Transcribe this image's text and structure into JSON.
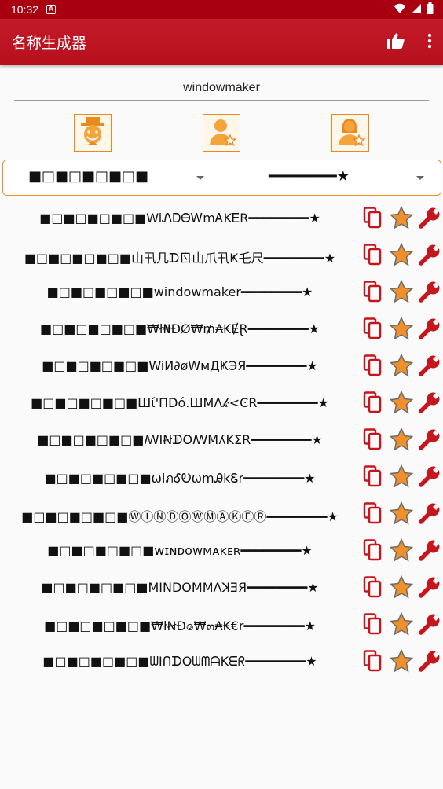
{
  "status_bar": {
    "time": "10:32",
    "notification_glyph": "A"
  },
  "app_bar": {
    "title": "名称生成器"
  },
  "input": {
    "value": "windowmaker"
  },
  "selectors": {
    "prefix": "■□■□■□■□■",
    "suffix": "━━━━━━━━★"
  },
  "names": [
    "■□■□■□■□■WiᏁᎠᎾᎳmᎪKᎬR━━━━━━━━★",
    "■□■□■□■□■山卂几ᗪㄖ山爪卂Ҝ乇尺━━━━━━━━★",
    "■□■□■□■□■windowmaker━━━━━━━━★",
    "■□■□■□■□■₩ł₦ĐØ₩₥₳₭ɆⱤ━━━━━━━━★",
    "■□■□■□■□■WiИ∂øWмДҜЭЯ━━━━━━━━★",
    "■□■□■□■□■Шί'ПDό.ШМΛ𝓀<ϾR━━━━━━━━★",
    "■□■□■□■□■ꟿIꞤᗫOꟿMʎKΣR━━━━━━━━★",
    "■□■□■□■□■ωiภᎴᎧωmᎯkᏋr━━━━━━━━★",
    "■□■□■□■□■ⓌⒾⓃⒹⓄⓌⓂⒶⓀⒺⓇ━━━━━━━━★",
    "■□■□■□■□■ᴡɪɴᴅᴏᴡᴍᴀᴋᴇʀ━━━━━━━━★",
    "■□■□■□■□■MINDOMMɅꓘƎЯ━━━━━━━━★",
    "■□■□■□■□■₩łꞤÐ๏₩๓₳₭€r━━━━━━━━★",
    "■□■□■□■□■ᗯIᑎᗪOᗯᗰᗩKᗴᖇ━━━━━━━━★"
  ],
  "colors": {
    "primary": "#b7101d",
    "accent": "#f0902a",
    "star": "#f0902a",
    "wrench": "#c4161c",
    "copy": "#c4161c"
  },
  "icons": [
    "thumb-up-icon",
    "more-vert-icon",
    "joker-avatar-icon",
    "male-star-avatar-icon",
    "female-star-avatar-icon",
    "copy-icon",
    "star-icon",
    "wrench-icon"
  ]
}
